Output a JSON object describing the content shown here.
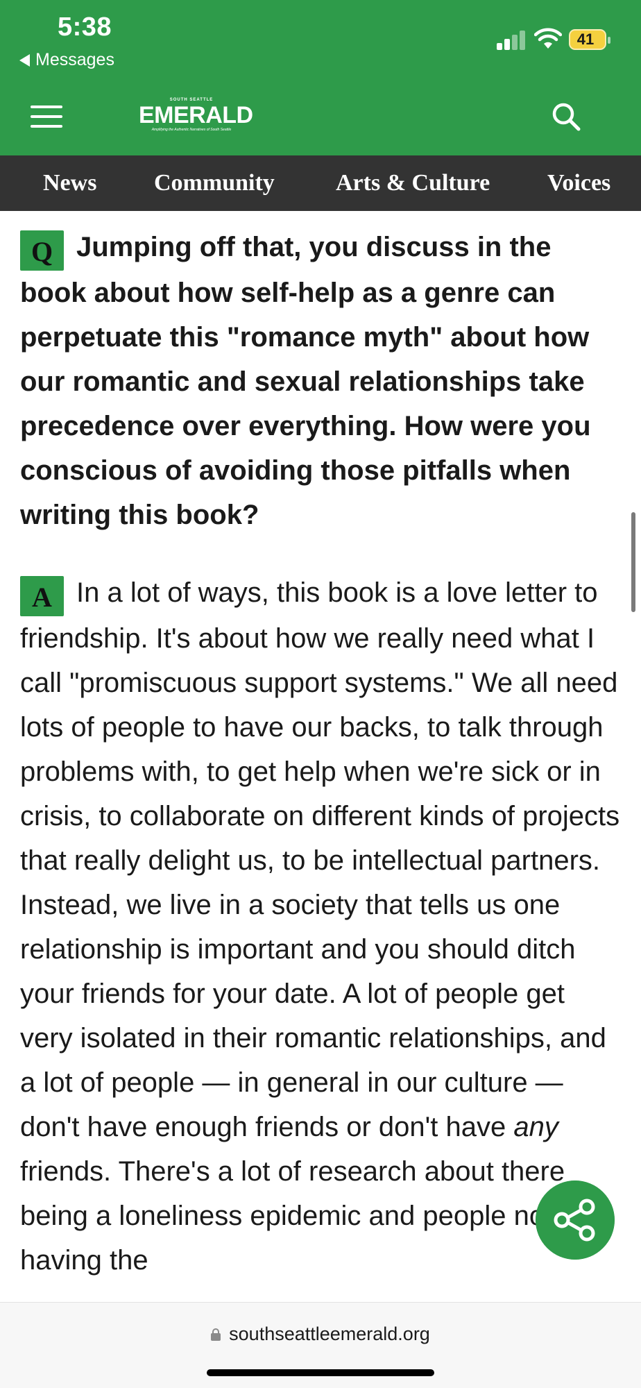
{
  "status_bar": {
    "time": "5:38",
    "back_label": "Messages",
    "battery": "41"
  },
  "header": {
    "logo_small": "SOUTH SEATTLE",
    "logo_main": "EMERALD",
    "logo_tagline": "Amplifying the Authentic Narratives of South Seattle",
    "brand_color": "#2e9b4a"
  },
  "nav": {
    "items": [
      "News",
      "Community",
      "Arts & Culture",
      "Voices"
    ]
  },
  "article": {
    "q_badge": "Q",
    "question": "Jumping off that, you discuss in the book about how self-help as a genre can perpetuate this \"romance myth\" about how our romantic and sexual relationships take precedence over everything. How were you conscious of avoiding those pitfalls when writing this book?",
    "a_badge": "A",
    "answer_part1": "In a lot of ways, this book is a love letter to friendship. It's about how we really need what I call \"promiscuous support systems.\" We all need lots of people to have our backs, to talk through problems with, to get help when we're sick or in crisis, to collaborate on different kinds of projects that really delight us, to be intellectual partners. Instead, we live in a society that tells us one relationship is important and you should ditch your friends for your date. A lot of people get very isolated in their romantic relationships, and a lot of people — in general in our culture — don't have enough friends or don't have ",
    "answer_emph": "any",
    "answer_part2": " friends. There's a lot of research about there being a loneliness epidemic and people not having the"
  },
  "browser": {
    "url": "southseattleemerald.org"
  }
}
